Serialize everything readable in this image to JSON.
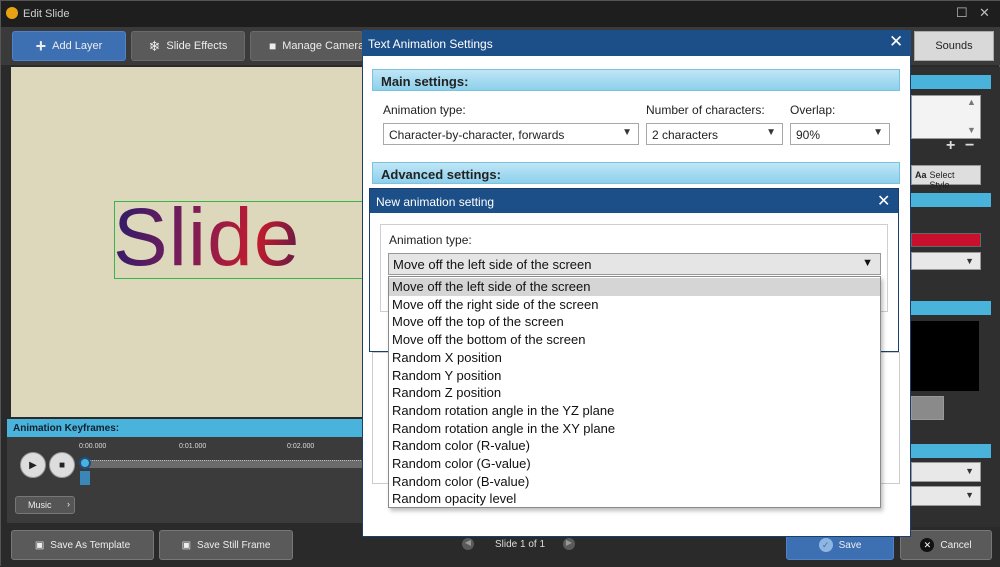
{
  "window": {
    "title": "Edit Slide"
  },
  "toolbar": {
    "add_layer": "Add Layer",
    "slide_effects": "Slide Effects",
    "manage_camera": "Manage Camera",
    "sounds_tab": "Sounds"
  },
  "canvas": {
    "slide_text": "Slide"
  },
  "right_panel": {
    "select_style": "Select Style",
    "aa_label": "Aa"
  },
  "keyframes": {
    "title": "Animation Keyframes:",
    "ticks": [
      "0:00.000",
      "0:01.000",
      "0:02.000"
    ],
    "music_label": "Music"
  },
  "bottom": {
    "save_template": "Save As Template",
    "save_still": "Save Still Frame",
    "slide_counter": "Slide 1 of 1",
    "save": "Save",
    "cancel": "Cancel"
  },
  "text_animation_dialog": {
    "title": "Text Animation Settings",
    "main_settings": "Main settings:",
    "animation_type_label": "Animation type:",
    "animation_type_value": "Character-by-character, forwards",
    "num_chars_label": "Number of characters:",
    "num_chars_value": "2 characters",
    "overlap_label": "Overlap:",
    "overlap_value": "90%",
    "advanced_settings": "Advanced settings:"
  },
  "new_animation_dialog": {
    "title": "New animation setting",
    "animation_type_label": "Animation type:",
    "selected": "Move off the left side of the screen",
    "options": [
      "Move off the left side of the screen",
      "Move off the right side of the screen",
      "Move off the top of the screen",
      "Move off the bottom of the screen",
      "Random X position",
      "Random Y position",
      "Random Z position",
      "Random rotation angle in the YZ plane",
      "Random rotation angle in the XY plane",
      "Random color (R-value)",
      "Random color (G-value)",
      "Random color (B-value)",
      "Random opacity level"
    ]
  },
  "colors": {
    "accent": "#1c4f88",
    "section": "#8dd0ec",
    "primary_button": "#3d6fb3"
  }
}
